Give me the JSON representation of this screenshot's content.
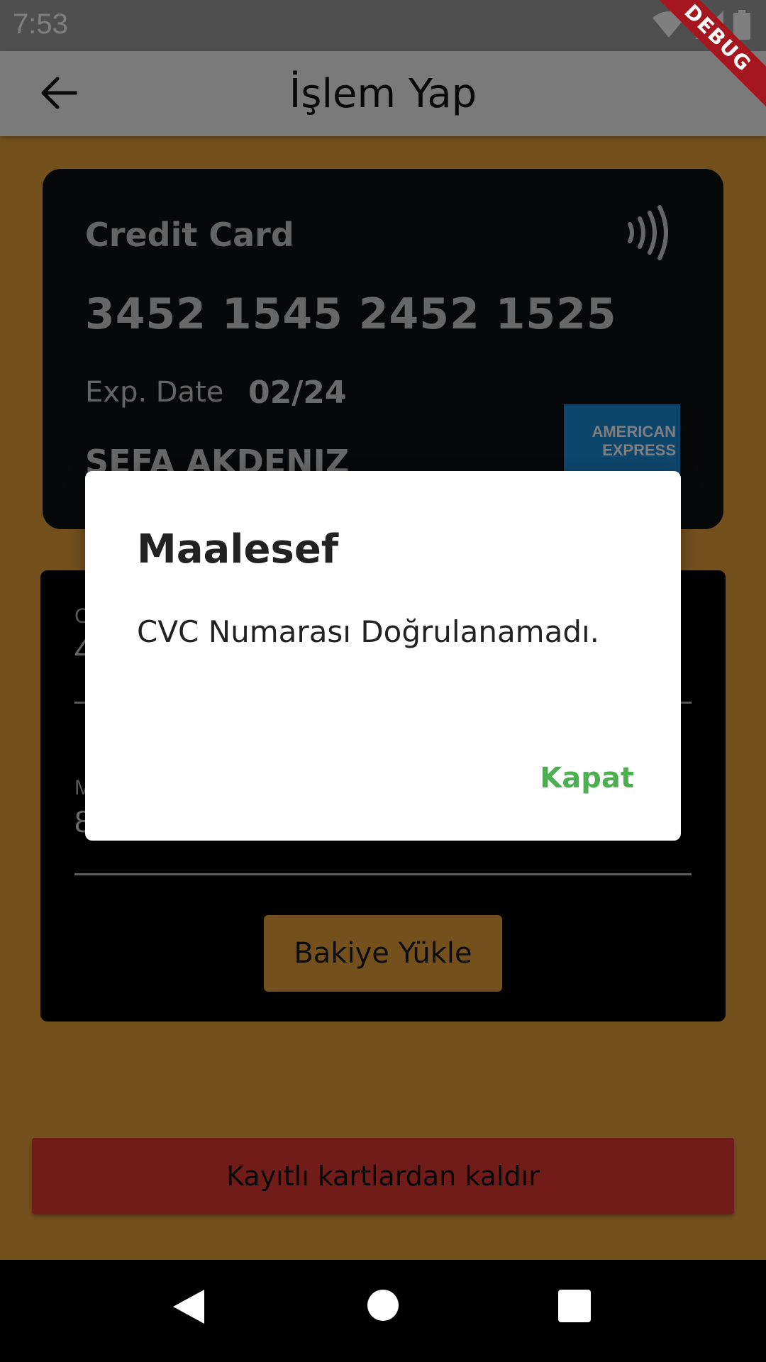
{
  "status_bar": {
    "time": "7:53",
    "icons": [
      "wifi-icon",
      "cellular-signal-icon",
      "battery-icon"
    ]
  },
  "debug_banner": "DEBUG",
  "app_bar": {
    "back_icon": "arrow-back-icon",
    "title": "İşlem Yap"
  },
  "credit_card": {
    "type_label": "Credit Card",
    "number": "3452 1545 2452 1525",
    "exp_label": "Exp. Date",
    "exp_value": "02/24",
    "holder_name": "SEFA AKDENIZ",
    "nfc_icon": "contactless-icon",
    "brand_logo": "AMERICAN EXPRESS",
    "brand_line1": "AMERICAN",
    "brand_line2": "EXPRESS"
  },
  "form": {
    "field1_label": "C",
    "field1_value": "4",
    "field2_label": "M",
    "field2_value": "8",
    "load_button": "Bakiye Yükle"
  },
  "remove_button": "Kayıtlı kartlardan kaldır",
  "dialog": {
    "title": "Maalesef",
    "message": "CVC Numarası Doğrulanamadı.",
    "action": "Kapat"
  },
  "nav_bar": {
    "icons": [
      "nav-back-icon",
      "nav-home-icon",
      "nav-recents-icon"
    ]
  },
  "colors": {
    "background": "#e9a13b",
    "card": "#0f1013",
    "remove_button": "#e53935",
    "dialog_action": "#4caf50",
    "debug_banner": "#a5161f"
  }
}
